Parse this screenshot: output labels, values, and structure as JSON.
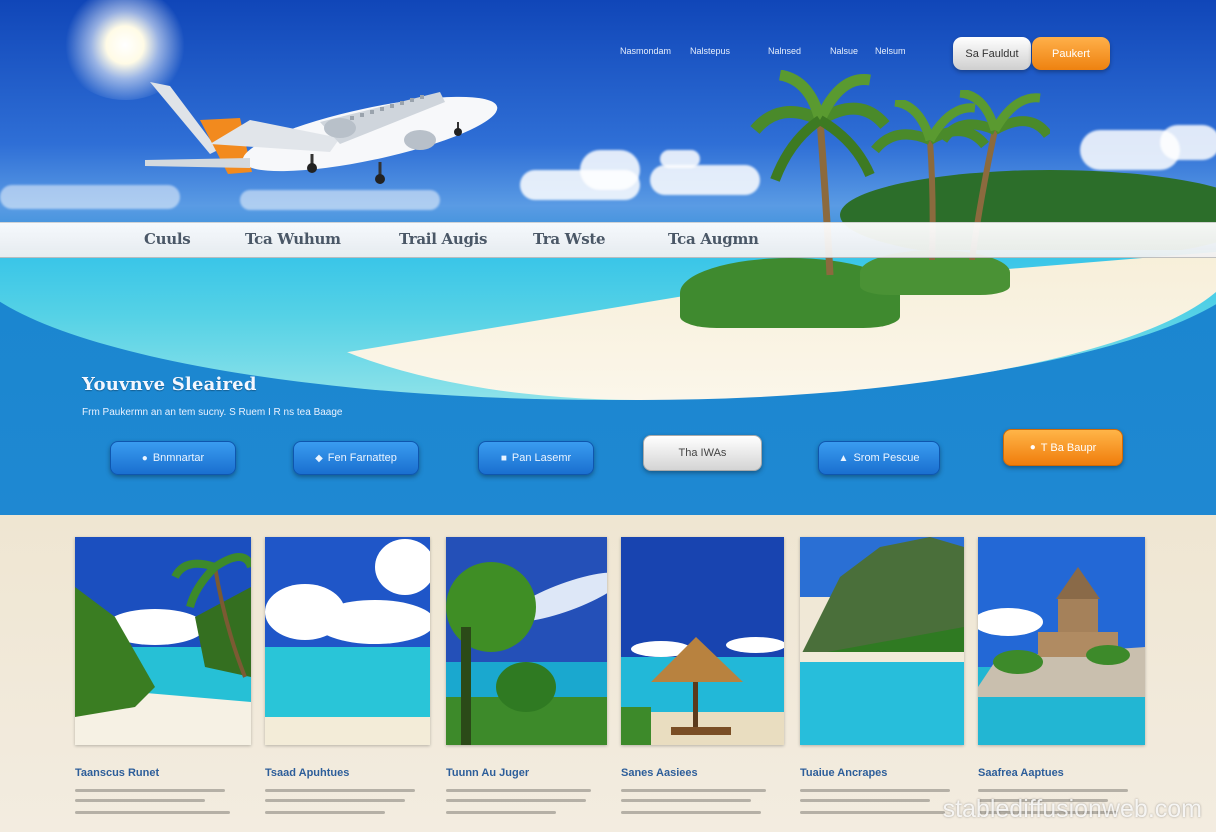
{
  "top_nav": {
    "links": [
      "Nasmondam",
      "Nalstepus",
      "Nalnsed",
      "Nalsue",
      "Nelsum"
    ],
    "buttons": [
      {
        "label": "Sa Fauldut"
      },
      {
        "label": "Paukert"
      }
    ]
  },
  "main_nav": {
    "items": [
      "Cuuls",
      "Tca Wuhum",
      "Trail Augis",
      "Tra Wste",
      "Tca Augmn"
    ]
  },
  "hero": {
    "title": "Youvnve Sleaired",
    "subtitle": "Frm Paukermn an an tem sucny.  S Ruem I R ns tea Baage"
  },
  "actions": [
    {
      "label": "Bnmnartar",
      "icon": "user-icon",
      "style": "blue"
    },
    {
      "label": "Fen Farnattep",
      "icon": "pin-icon",
      "style": "blue"
    },
    {
      "label": "Pan Lasemr",
      "icon": "hotel-icon",
      "style": "blue"
    },
    {
      "label": "Tha IWAs",
      "icon": "",
      "style": "grey"
    },
    {
      "label": "Srom Pescue",
      "icon": "bag-icon",
      "style": "blue"
    },
    {
      "label": "T Ba Baupr",
      "icon": "tag-icon",
      "style": "orange"
    }
  ],
  "cards": [
    {
      "title": "Taanscus Runet",
      "scene": "palm-beach"
    },
    {
      "title": "Tsaad Apuhtues",
      "scene": "cloud-lagoon"
    },
    {
      "title": "Tuunn Au Juger",
      "scene": "tree-coast"
    },
    {
      "title": "Sanes Aasiees",
      "scene": "hut-beach"
    },
    {
      "title": "Tuaiue Ancrapes",
      "scene": "mountain-pool"
    },
    {
      "title": "Saafrea Aaptues",
      "scene": "temple-island"
    }
  ],
  "watermark": "stablediffusionweb.com",
  "colors": {
    "accent_orange": "#f08a14",
    "accent_blue": "#1a6fd0",
    "link_blue": "#2d5e9a"
  }
}
